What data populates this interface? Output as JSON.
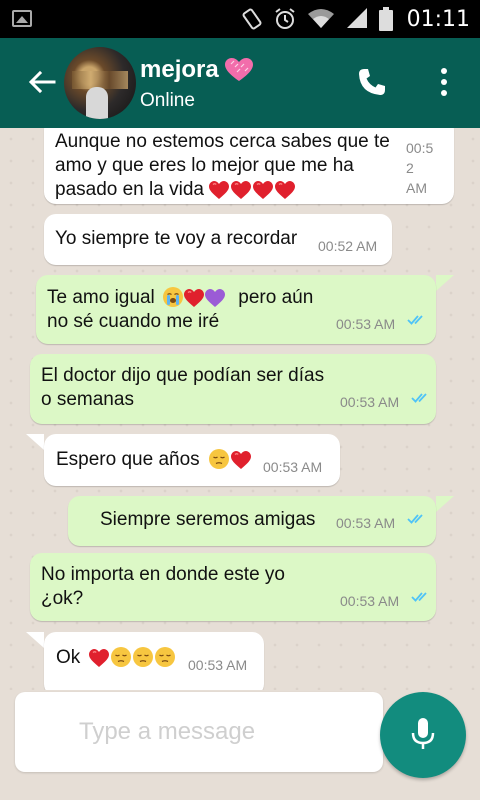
{
  "status_bar": {
    "time": "01:11"
  },
  "header": {
    "contact_name": "mejora",
    "contact_status": "Online"
  },
  "messages": [
    {
      "direction": "in",
      "lines": [
        "Aunque no estemos cerca sabes que te",
        "amo y que eres lo mejor que me ha",
        "pasado en la vida"
      ],
      "time_lines": [
        "00:5",
        "2",
        "AM"
      ]
    },
    {
      "direction": "in",
      "text": "Yo siempre te voy a recordar",
      "time": "00:52 AM"
    },
    {
      "direction": "out",
      "lines": [
        "Te amo igual",
        "no sé cuando me iré"
      ],
      "line1_suffix": "pero aún",
      "time": "00:53 AM"
    },
    {
      "direction": "out",
      "lines": [
        "El doctor dijo que podían ser días",
        "o semanas"
      ],
      "time": "00:53 AM"
    },
    {
      "direction": "in",
      "text": "Espero que años",
      "time": "00:53 AM"
    },
    {
      "direction": "out",
      "text": "Siempre seremos amigas",
      "time": "00:53 AM"
    },
    {
      "direction": "out",
      "lines": [
        "No importa en donde este yo",
        "¿ok?"
      ],
      "time": "00:53 AM"
    },
    {
      "direction": "in",
      "text": "Ok",
      "time": "00:53 AM"
    }
  ],
  "composer": {
    "placeholder": "Type a message"
  },
  "colors": {
    "header": "#075e54",
    "outgoing_bubble": "#dcf8c6",
    "incoming_bubble": "#ffffff",
    "mic_button": "#128c7e",
    "read_ticks": "#4fc3f7"
  },
  "icons": [
    "image-icon",
    "vibrate-icon",
    "alarm-icon",
    "wifi-icon",
    "signal-icon",
    "battery-icon",
    "back-arrow-icon",
    "heart-icon",
    "phone-icon",
    "more-vert-icon",
    "double-check-icon",
    "mic-icon"
  ]
}
